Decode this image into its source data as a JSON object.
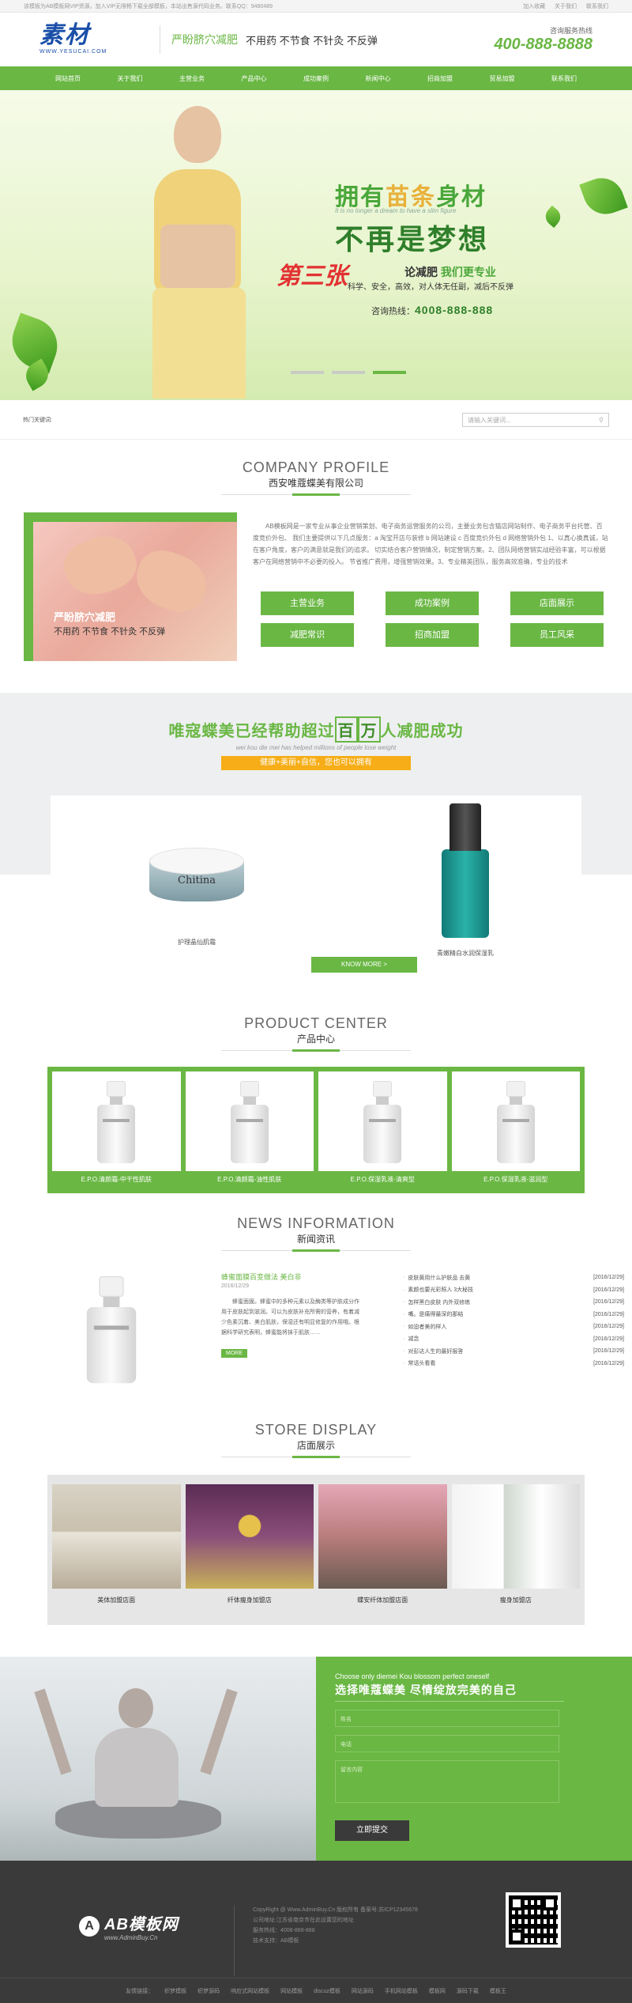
{
  "topbar": {
    "left": "该模板为AB模板网VIP资源，加入VIP无限畅下载全部模板，本站出售源代码业务。联系QQ：9480489",
    "links": [
      "加入收藏",
      "关于我们",
      "联系我们"
    ]
  },
  "header": {
    "logo_big": "素材",
    "logo_url": "WWW.YESUCAI.COM",
    "slogan_green": "严盼脐穴减肥",
    "slogan_black": "不用药 不节食 不针灸 不反弹",
    "hotline_label": "咨询服务热线",
    "hotline_number": "400-888-8888"
  },
  "nav": [
    "网站首页",
    "关于我们",
    "主营业务",
    "产品中心",
    "成功案例",
    "新闻中心",
    "招商加盟",
    "贸易加盟",
    "联系我们"
  ],
  "banner": {
    "h1_a": "拥有",
    "h1_b": "苗条",
    "h1_c": "身材",
    "en": "It is no longer a dream to have a slim figure",
    "h2": "不再是梦想",
    "third": "第三张",
    "sub_a": "论减肥 ",
    "sub_b": "我们更专业",
    "sub2": "科学、安全，高效，对人体无任副，减后不反弹",
    "hotline_label": "咨询热线：",
    "hotline": "4008-888-888",
    "slides_total": 3,
    "active_slide": 3
  },
  "search": {
    "keywords_label": "热门关键词:",
    "placeholder": "请输入关键词..."
  },
  "company": {
    "title_en": "COMPANY PROFILE",
    "title_cn": "西安唯蔻蝶美有限公司",
    "image_title": "严盼脐穴减肥",
    "image_sub": "不用药 不节食 不针灸 不反弹",
    "text": "AB模板网是一家专业从事企业营销策划、电子商务运营服务的公司，主要业务包含猫店网站制作、电子商务平台托管、百度竞价外包、 我们主要提供以下几点服务：a 淘宝开店与装修 b 网站建设 c 百度竞价外包 d 网络营销外包 1、以真心换真诚，站在客户角度，客户的满意就是我们的追求。 切实结合客户营销情况，制定营销方案。2、团队网络营销实战经验丰富，可以根据客户在网络营销中不必要的投入。 节省推广费用，增强营销效果。3、专业精英团队，服务高效准确，专业的技术",
    "buttons": [
      "主营业务",
      "成功案例",
      "店面展示",
      "减肥常识",
      "招商加盟",
      "员工风采"
    ]
  },
  "stats": {
    "h_a": "唯寇蝶美已经帮助超过",
    "h_box1": "百",
    "h_box2": "万",
    "h_b": "人减肥成功",
    "en": "wei kou die mei has helped millions of people lose weight",
    "badge": "健康+美丽+自信，您也可以拥有",
    "products": [
      {
        "name": "护理晶仙肌霜",
        "brand": "Chitina"
      },
      {
        "name": "青嫩精白水润保湿乳"
      }
    ],
    "more": "KNOW MORE >"
  },
  "pcenter": {
    "title_en": "PRODUCT CENTER",
    "title_cn": "产品中心",
    "items": [
      "E.P.O.清颜霜-中干性肌肤",
      "E.P.O.清颜霜-油性肌肤",
      "E.P.O.保湿乳液-清爽型",
      "E.P.O.保湿乳液-滋润型"
    ]
  },
  "news": {
    "title_en": "NEWS INFORMATION",
    "title_cn": "新闻资讯",
    "featured": {
      "title": "蜂蜜面膜百变做法 美白非",
      "date": "2016/12/29",
      "text": "蜂蜜面膜。蜂蜜中的多种元素以及酶类等护肤成分作用于皮肤起到滋润。可以为皮肤补充所需的营养，有着减少色素沉着、美白肌肤，保湿还有明显修复的作用哦。根据科学研究表明，蜂蜜能将抹于肌肤……",
      "more": "MORE"
    },
    "list": [
      {
        "title": "皮肤黄用什么护肤品 去黄",
        "date": "[2016/12/29]"
      },
      {
        "title": "素颜也要光彩照人 3大秘技",
        "date": "[2016/12/29]"
      },
      {
        "title": "怎样黑白皮肤 内外双修练",
        "date": "[2016/12/29]"
      },
      {
        "title": "嘴。是痛得最深的那结",
        "date": "[2016/12/29]"
      },
      {
        "title": "如迫者美的样人",
        "date": "[2016/12/29]"
      },
      {
        "title": "减念",
        "date": "[2016/12/29]"
      },
      {
        "title": "对彭达人生的最好报答",
        "date": "[2016/12/29]"
      },
      {
        "title": "常话头看看",
        "date": "[2016/12/29]"
      }
    ]
  },
  "store": {
    "title_en": "STORE DISPLAY",
    "title_cn": "店面展示",
    "items": [
      "美体加盟店面",
      "纤体瘦身加盟店",
      "蝶安纤体加盟店面",
      "瘦身加盟店"
    ]
  },
  "contact": {
    "en": "Choose only diemei Kou blossom perfect oneself",
    "cn": "选择唯蔻蝶美 尽情绽放完美的自己",
    "name_ph": "姓名",
    "phone_ph": "电话",
    "msg_ph": "留言内容",
    "submit": "立即提交"
  },
  "footer": {
    "logo_letter": "A",
    "logo_name": "AB模板网",
    "logo_url": "www.AdminBuy.Cn",
    "info": [
      "CopyRight @ Www.AdminBuy.Cn 版权所有    备案号:苏ICP12345678",
      "公司地址:江苏省南京市在此设置您的地址",
      "服务热线：4008-888-888",
      "技术支持：AB模板"
    ],
    "links": [
      "友情链接：",
      "织梦模板",
      "织梦源码",
      "响应式网站模板",
      "网站模板",
      "discuz模板",
      "网站源码",
      "手机网站模板",
      "模板网",
      "源码下载",
      "模板王"
    ]
  },
  "colors": {
    "green": "#6ab744",
    "orange": "#f6ad17",
    "dark": "#3a3a3a"
  }
}
